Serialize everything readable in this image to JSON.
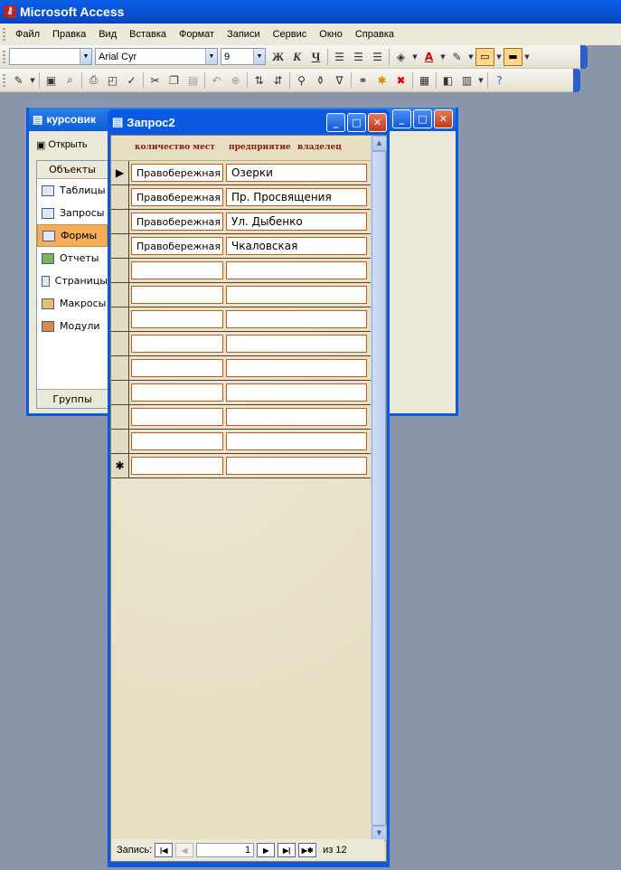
{
  "app": {
    "title": "Microsoft Access"
  },
  "menu": [
    "Файл",
    "Правка",
    "Вид",
    "Вставка",
    "Формат",
    "Записи",
    "Сервис",
    "Окно",
    "Справка"
  ],
  "format_toolbar": {
    "object_value": "",
    "font": "Arial Cyr",
    "size": "9",
    "bold": "Ж",
    "italic": "К",
    "underline": "Ч",
    "font_color_letter": "A"
  },
  "db_window": {
    "title": "курсовик",
    "open_label": "Открыть",
    "objects_header": "Объекты",
    "items": [
      "Таблицы",
      "Запросы",
      "Формы",
      "Отчеты",
      "Страницы",
      "Макросы",
      "Модули"
    ],
    "selected": "Формы",
    "groups_label": "Группы"
  },
  "form_window": {
    "title": "Запрос2",
    "headers": {
      "seats": "количество мест",
      "company": "предприятие",
      "owner": "владелец"
    },
    "rows": [
      {
        "marker": "▶",
        "c1": "Правобережная",
        "c2": "Озерки"
      },
      {
        "marker": "",
        "c1": "Правобережная",
        "c2": "Пр. Просвящения"
      },
      {
        "marker": "",
        "c1": "Правобережная",
        "c2": "Ул. Дыбенко"
      },
      {
        "marker": "",
        "c1": "Правобережная",
        "c2": "Чкаловская"
      },
      {
        "marker": "",
        "c1": "",
        "c2": ""
      },
      {
        "marker": "",
        "c1": "",
        "c2": ""
      },
      {
        "marker": "",
        "c1": "",
        "c2": ""
      },
      {
        "marker": "",
        "c1": "",
        "c2": ""
      },
      {
        "marker": "",
        "c1": "",
        "c2": ""
      },
      {
        "marker": "",
        "c1": "",
        "c2": ""
      },
      {
        "marker": "",
        "c1": "",
        "c2": ""
      },
      {
        "marker": "",
        "c1": "",
        "c2": ""
      },
      {
        "marker": "✱",
        "c1": "",
        "c2": ""
      }
    ],
    "nav": {
      "label": "Запись:",
      "current": "1",
      "of": "из",
      "total": "12"
    }
  },
  "colors": {
    "titlebar": "#0854d8",
    "cell_border": "#c05a17",
    "header_text": "#8b1a00",
    "selected_item": "#f5ad57"
  }
}
